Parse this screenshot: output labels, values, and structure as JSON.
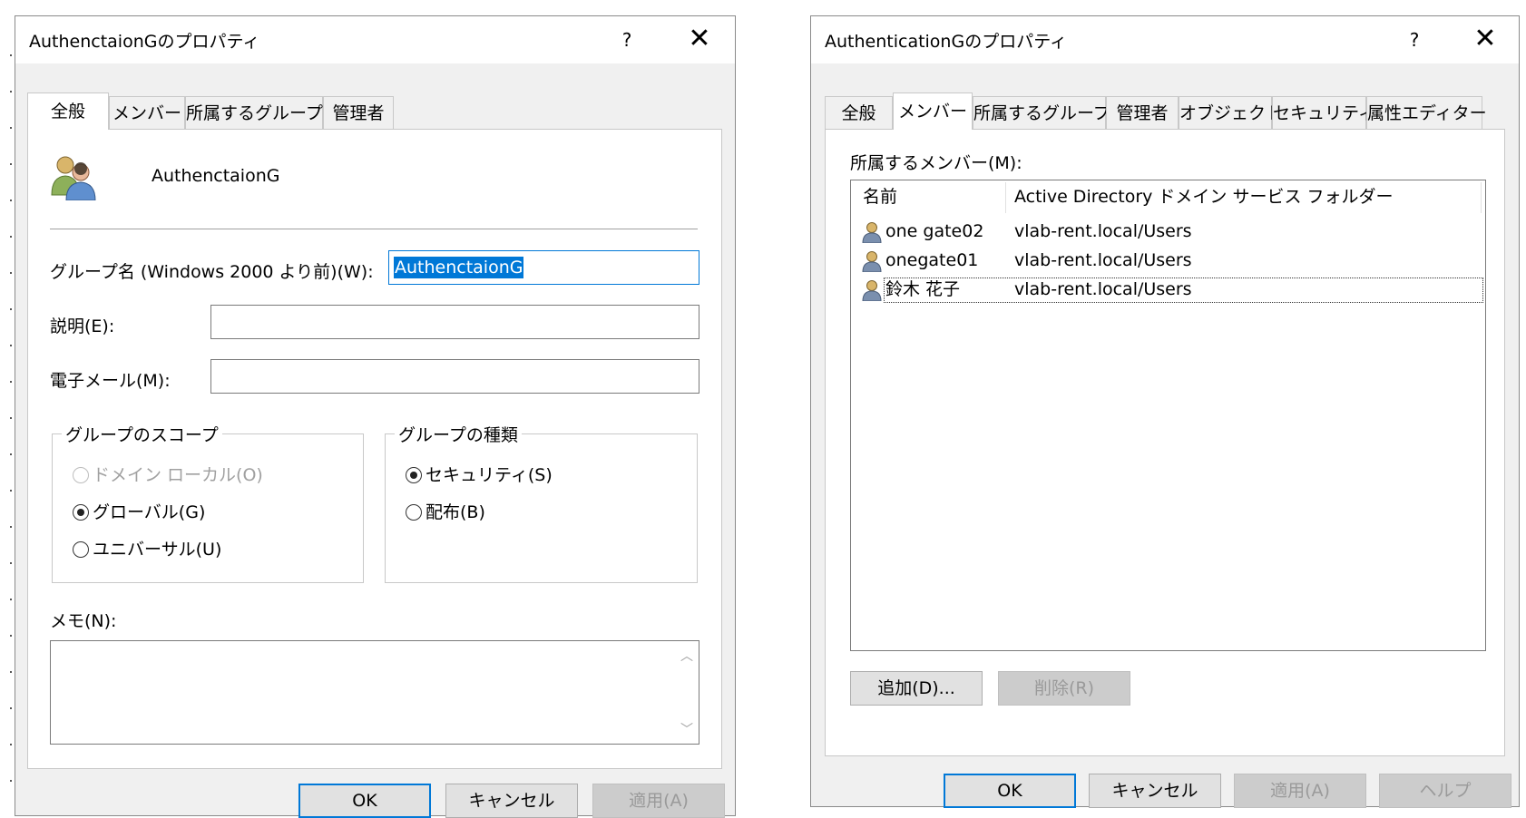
{
  "left": {
    "title": "AuthenctaionGのプロパティ",
    "help": "?",
    "close": "✕",
    "tabs": [
      "全般",
      "メンバー",
      "所属するグループ",
      "管理者"
    ],
    "group_name": "AuthenctaionG",
    "label_pre2000": "グループ名 (Windows 2000 より前)(W):",
    "pre2000_value": "AuthenctaionG",
    "label_desc": "説明(E):",
    "desc_value": "",
    "label_email": "電子メール(M):",
    "email_value": "",
    "scope": {
      "legend": "グループのスコープ",
      "options": [
        "ドメイン ローカル(O)",
        "グローバル(G)",
        "ユニバーサル(U)"
      ],
      "selected": "グローバル(G)"
    },
    "type": {
      "legend": "グループの種類",
      "options": [
        "セキュリティ(S)",
        "配布(B)"
      ],
      "selected": "セキュリティ(S)"
    },
    "label_memo": "メモ(N):",
    "memo_value": "",
    "buttons": {
      "ok": "OK",
      "cancel": "キャンセル",
      "apply": "適用(A)"
    }
  },
  "right": {
    "title": "AuthenticationGのプロパティ",
    "help": "?",
    "close": "✕",
    "tabs": [
      "全般",
      "メンバー",
      "所属するグループ",
      "管理者",
      "オブジェクト",
      "セキュリティ",
      "属性エディター"
    ],
    "members_label": "所属するメンバー(M):",
    "columns": [
      "名前",
      "Active Directory ドメイン サービス フォルダー"
    ],
    "members": [
      {
        "name": "one gate02",
        "folder": "vlab-rent.local/Users"
      },
      {
        "name": "onegate01",
        "folder": "vlab-rent.local/Users"
      },
      {
        "name": "鈴木 花子",
        "folder": "vlab-rent.local/Users"
      }
    ],
    "buttons": {
      "add": "追加(D)...",
      "remove": "削除(R)",
      "ok": "OK",
      "cancel": "キャンセル",
      "apply": "適用(A)",
      "help": "ヘルプ"
    }
  },
  "icons": {
    "group": "group-users-icon",
    "user": "user-icon",
    "scroll_up": "chevron-up-icon",
    "scroll_down": "chevron-down-icon"
  }
}
